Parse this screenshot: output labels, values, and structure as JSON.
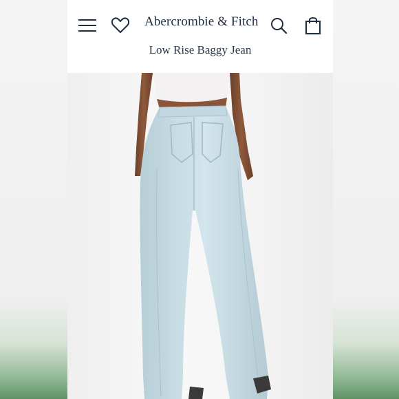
{
  "header": {
    "brand": "Abercrombie & Fitch",
    "product_title": "Low Rise Baggy Jean"
  },
  "icons": {
    "menu": "hamburger-menu-icon",
    "wishlist": "heart-icon",
    "search": "search-icon",
    "bag": "shopping-bag-icon"
  },
  "colors": {
    "brand_text": "#1f2d3f",
    "denim": "#c7dde6"
  }
}
